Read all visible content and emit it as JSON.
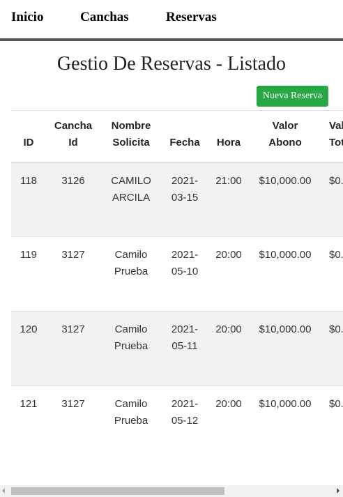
{
  "nav": {
    "items": [
      {
        "label": "Inicio"
      },
      {
        "label": "Canchas"
      },
      {
        "label": "Reservas"
      }
    ]
  },
  "page": {
    "title": "Gestio De Reservas - Listado",
    "new_button_label": "Nueva Reserva"
  },
  "table": {
    "headers": {
      "id": "ID",
      "cancha": [
        "Cancha",
        "Id"
      ],
      "nombre": [
        "Nombre",
        "Solicita"
      ],
      "fecha": "Fecha",
      "hora": "Hora",
      "valor_abono": [
        "Valor",
        "Abono"
      ],
      "valor_total": [
        "Val",
        "Tot"
      ]
    },
    "rows": [
      {
        "id": "118",
        "cancha": "3126",
        "nombre": [
          "CAMILO",
          "ARCILA"
        ],
        "fecha": [
          "2021-",
          "03-15"
        ],
        "hora": "21:00",
        "abono": "$10,000.00",
        "total": "$0."
      },
      {
        "id": "119",
        "cancha": "3127",
        "nombre": [
          "Camilo",
          "Prueba"
        ],
        "fecha": [
          "2021-",
          "05-10"
        ],
        "hora": "20:00",
        "abono": "$10,000.00",
        "total": "$0."
      },
      {
        "id": "120",
        "cancha": "3127",
        "nombre": [
          "Camilo",
          "Prueba"
        ],
        "fecha": [
          "2021-",
          "05-11"
        ],
        "hora": "20:00",
        "abono": "$10,000.00",
        "total": "$0."
      },
      {
        "id": "121",
        "cancha": "3127",
        "nombre": [
          "Camilo",
          "Prueba"
        ],
        "fecha": [
          "2021-",
          "05-12"
        ],
        "hora": "20:00",
        "abono": "$10,000.00",
        "total": "$0."
      }
    ]
  },
  "colors": {
    "accent_green": "#28a745",
    "nav_bar": "#555555",
    "row_stripe": "#f2f2f2"
  }
}
